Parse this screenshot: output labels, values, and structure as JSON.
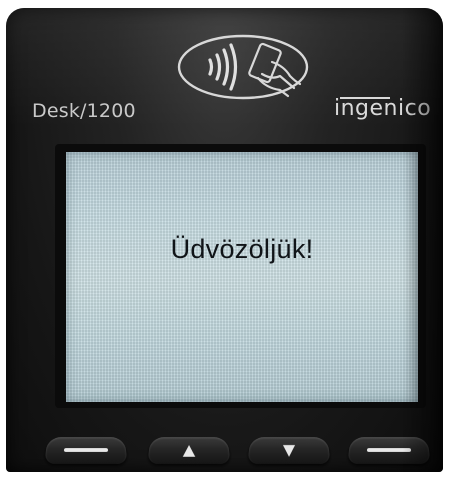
{
  "device": {
    "model": "Desk/1200",
    "brand": "ingenico",
    "contactless_symbol": "contactless-payment-icon"
  },
  "screen": {
    "message": "Üdvözöljük!"
  },
  "keys": [
    {
      "icon": "dash-icon",
      "glyph": ""
    },
    {
      "icon": "up-arrow-icon",
      "glyph": "▲"
    },
    {
      "icon": "down-arrow-icon",
      "glyph": "▼"
    },
    {
      "icon": "dash-icon",
      "glyph": ""
    }
  ],
  "colors": {
    "body": "#1a1a1a",
    "lcd_background": "#c7dde4",
    "lcd_text": "#101418",
    "label": "#c9c9c9"
  }
}
